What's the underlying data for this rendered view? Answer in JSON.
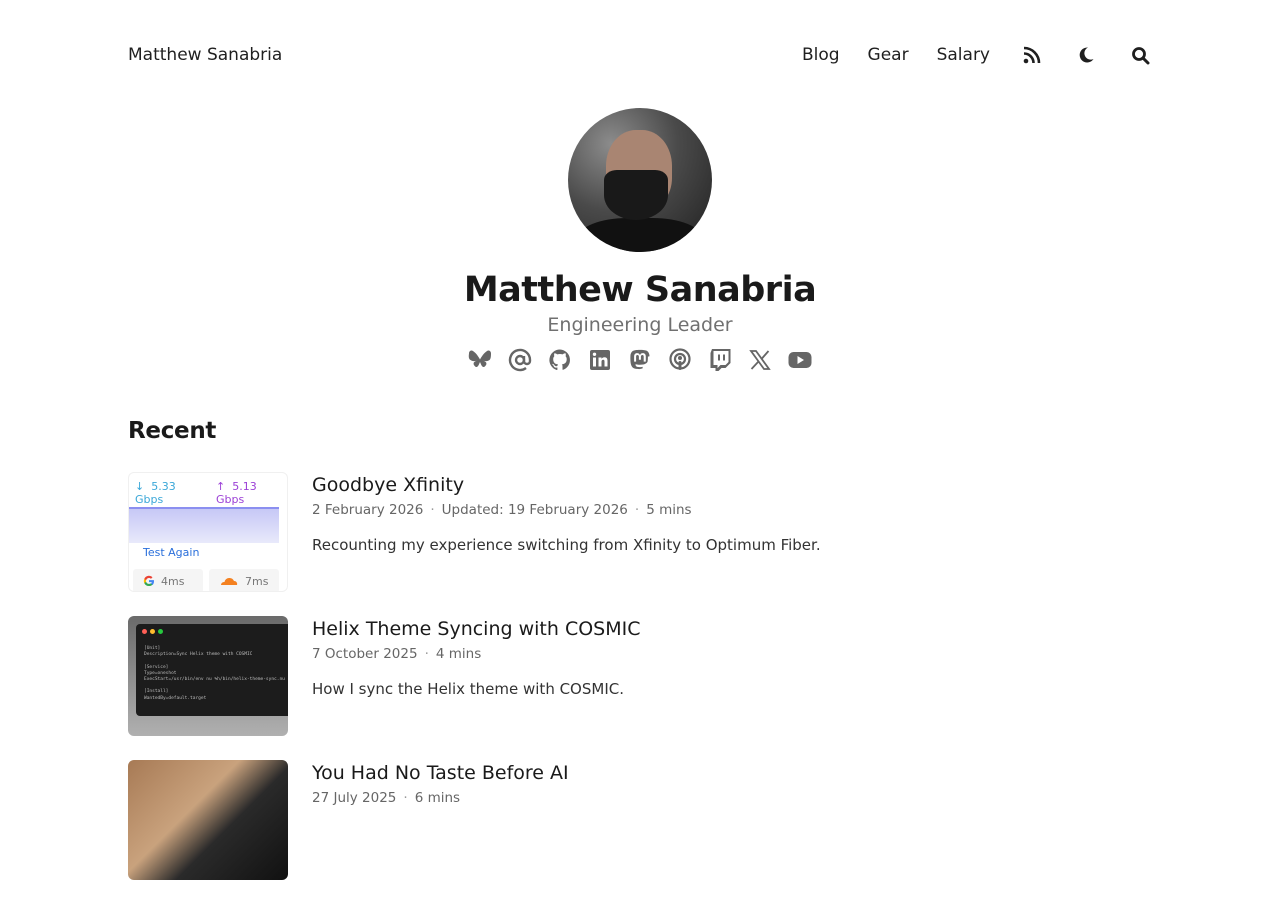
{
  "header": {
    "site_name": "Matthew Sanabria",
    "nav": [
      {
        "label": "Blog"
      },
      {
        "label": "Gear"
      },
      {
        "label": "Salary"
      }
    ],
    "icons": [
      "rss-icon",
      "moon-icon",
      "search-icon"
    ]
  },
  "profile": {
    "name": "Matthew Sanabria",
    "tagline": "Engineering Leader",
    "socials": [
      "bluesky-icon",
      "email-icon",
      "github-icon",
      "linkedin-icon",
      "mastodon-icon",
      "podcast-icon",
      "twitch-icon",
      "x-icon",
      "youtube-icon"
    ]
  },
  "recent": {
    "title": "Recent",
    "posts": [
      {
        "title": "Goodbye Xfinity",
        "date": "2 February 2026",
        "updated": "Updated: 19 February 2026",
        "read_time": "5 mins",
        "description": "Recounting my experience switching from Xfinity to Optimum Fiber.",
        "thumb": {
          "down": "5.33 Gbps",
          "up": "5.13 Gbps",
          "again": "Test Again",
          "ping_google": "4ms",
          "ping_cloudflare": "7ms"
        }
      },
      {
        "title": "Helix Theme Syncing with COSMIC",
        "date": "7 October 2025",
        "read_time": "4 mins",
        "description": "How I sync the Helix theme with COSMIC."
      },
      {
        "title": "You Had No Taste Before AI",
        "date": "27 July 2025",
        "read_time": "6 mins"
      }
    ]
  },
  "colors": {
    "text": "#1f1f1f",
    "muted": "#707070",
    "icon": "#666666",
    "background": "#ffffff"
  }
}
